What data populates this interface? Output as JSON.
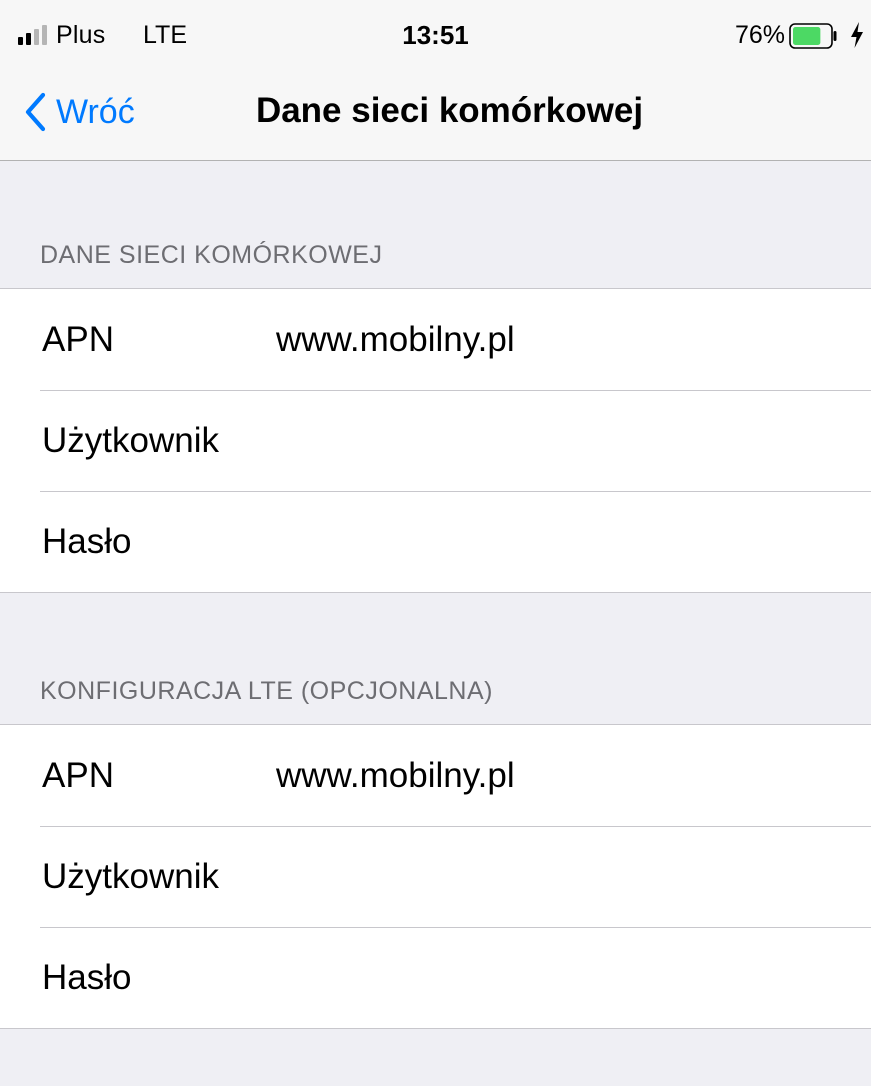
{
  "status_bar": {
    "carrier": "Plus",
    "network": "LTE",
    "time": "13:51",
    "battery_percent": "76%",
    "battery_level": 0.76,
    "battery_color": "#4cd964"
  },
  "nav": {
    "back_label": "Wróć",
    "title": "Dane sieci komórkowej",
    "accent_color": "#007aff"
  },
  "sections": [
    {
      "header": "DANE SIECI KOMÓRKOWEJ",
      "rows": [
        {
          "label": "APN",
          "value": "www.mobilny.pl"
        },
        {
          "label": "Użytkownik",
          "value": ""
        },
        {
          "label": "Hasło",
          "value": ""
        }
      ]
    },
    {
      "header": "KONFIGURACJA LTE (OPCJONALNA)",
      "rows": [
        {
          "label": "APN",
          "value": "www.mobilny.pl"
        },
        {
          "label": "Użytkownik",
          "value": ""
        },
        {
          "label": "Hasło",
          "value": ""
        }
      ]
    }
  ]
}
